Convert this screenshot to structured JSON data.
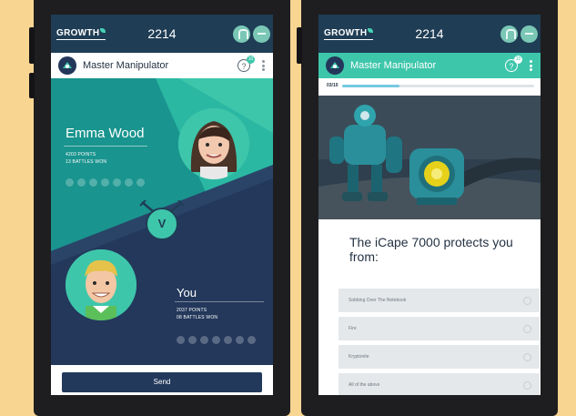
{
  "colors": {
    "background": "#f9d592",
    "navy": "#1f3d55",
    "teal": "#3ec6ab",
    "progress": "#74c9e0"
  },
  "left_phone": {
    "status_bar": {
      "logo": "GROWTH",
      "time": "2214",
      "icons": [
        "home-icon",
        "menu-icon"
      ]
    },
    "app_bar": {
      "title": "Master Manipulator",
      "badge": "10",
      "icons": [
        "help-icon",
        "kebab-menu-icon"
      ]
    },
    "player1": {
      "name": "Emma Wood",
      "points": "4203 POINTS",
      "battles": "13 BATTLES WON"
    },
    "vs_label": "V",
    "player2": {
      "name": "You",
      "points": "2037 POINTS",
      "battles": "08 BATTLES WON"
    },
    "send_button": "Send"
  },
  "right_phone": {
    "status_bar": {
      "logo": "GROWTH",
      "time": "2214",
      "icons": [
        "home-icon",
        "menu-icon"
      ]
    },
    "app_bar": {
      "title": "Master Manipulator",
      "badge": "10",
      "icons": [
        "help-icon",
        "kebab-menu-icon"
      ]
    },
    "progress": {
      "label": "03/10",
      "fraction": 0.3
    },
    "question": "The iCape 7000 protects you from:",
    "answers": [
      "Sobbing Over The Notebook",
      "Fire",
      "Kryptonite",
      "All of the above"
    ]
  }
}
